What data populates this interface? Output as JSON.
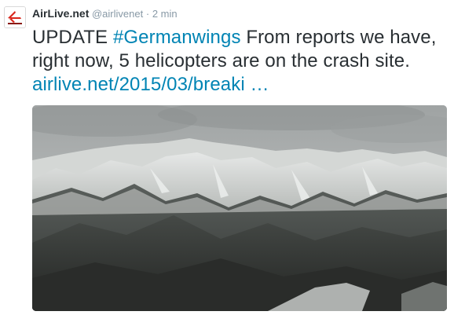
{
  "tweet": {
    "author_name": "AirLive.net",
    "author_handle": "@airlivenet",
    "separator": "·",
    "timestamp": "2 min",
    "text_prefix": "UPDATE ",
    "hashtag": "#Germanwings",
    "text_body": " From reports we have, right now, 5 helicopters are on the crash site. ",
    "link": "airlive.net/2015/03/breaki …",
    "avatar_icon": "airlive-logo-icon",
    "media_description_icon": "photo-icon"
  },
  "colors": {
    "link": "#0084b4",
    "text": "#292f33",
    "meta": "#8899a6",
    "logo_red": "#d9261c"
  }
}
